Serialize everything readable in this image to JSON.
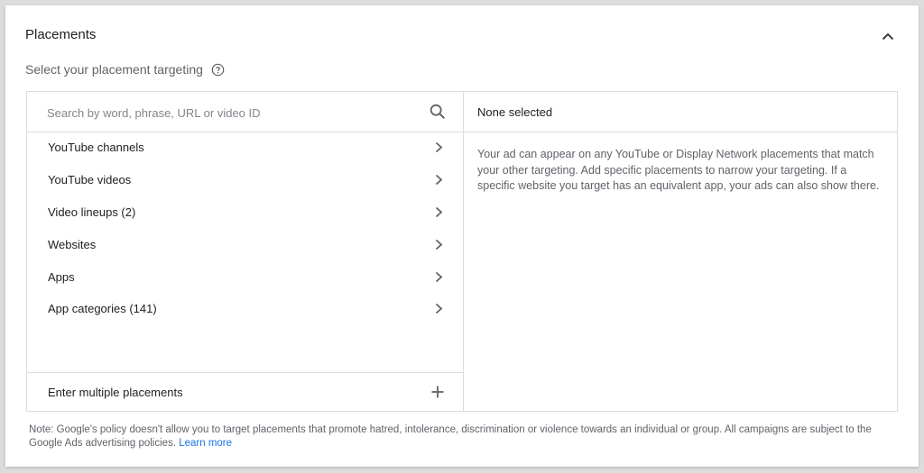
{
  "section": {
    "title": "Placements",
    "collapse_icon": "chevron-up-icon"
  },
  "subtitle": {
    "text": "Select your placement targeting",
    "help_icon": "help-circle-icon"
  },
  "search": {
    "placeholder": "Search by word, phrase, URL or video ID",
    "value": "",
    "icon": "search-icon"
  },
  "categories": [
    {
      "label": "YouTube channels"
    },
    {
      "label": "YouTube videos"
    },
    {
      "label": "Video lineups (2)"
    },
    {
      "label": "Websites"
    },
    {
      "label": "Apps"
    },
    {
      "label": "App categories (141)"
    }
  ],
  "enter_multiple": {
    "label": "Enter multiple placements",
    "icon": "plus-icon"
  },
  "selected": {
    "header": "None selected",
    "description": "Your ad can appear on any YouTube or Display Network placements that match your other targeting. Add specific placements to narrow your targeting. If a specific website you target has an equivalent app, your ads can also show there."
  },
  "note": {
    "text": "Note: Google's policy doesn't allow you to target placements that promote hatred, intolerance, discrimination or violence towards an individual or group. All campaigns are subject to the Google Ads advertising policies.",
    "link": "Learn more"
  },
  "colors": {
    "link": "#1a73e8",
    "border": "#dadce0",
    "secondary_text": "#5f6368"
  }
}
